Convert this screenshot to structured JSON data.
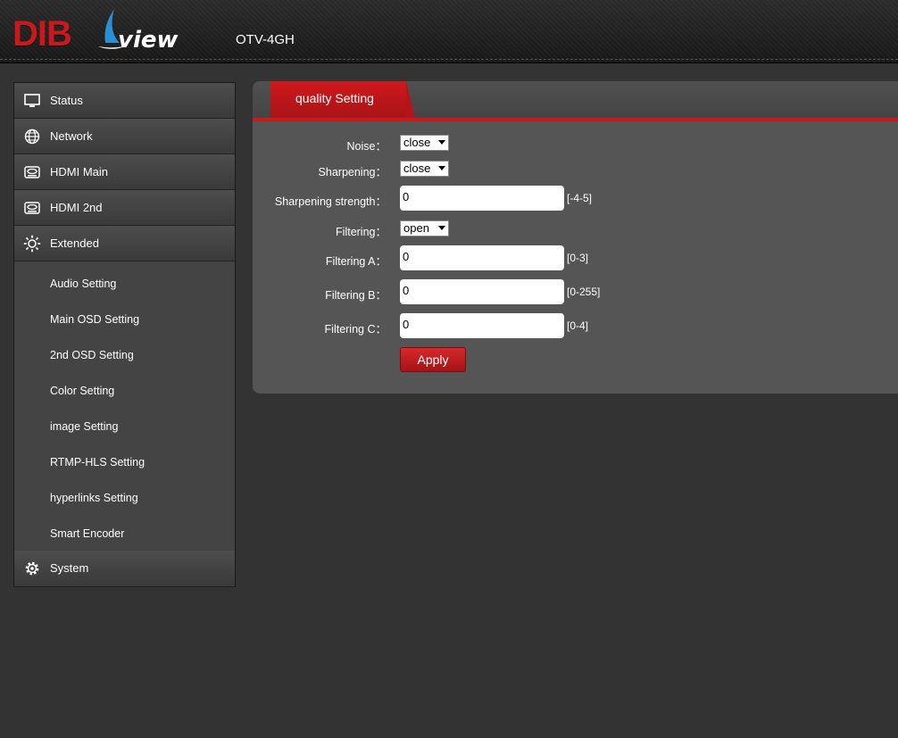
{
  "header": {
    "logo_main": "DIB",
    "logo_sub": "view",
    "model": "OTV-4GH"
  },
  "sidebar": {
    "items": [
      {
        "label": "Status",
        "icon": "monitor-icon"
      },
      {
        "label": "Network",
        "icon": "globe-icon"
      },
      {
        "label": "HDMI Main",
        "icon": "hdmi-icon"
      },
      {
        "label": "HDMI 2nd",
        "icon": "hdmi-icon"
      },
      {
        "label": "Extended",
        "icon": "sun-gear-icon"
      }
    ],
    "sub_items": [
      "Audio Setting",
      "Main OSD Setting",
      "2nd OSD Setting",
      "Color Setting",
      "image Setting",
      "RTMP-HLS Setting",
      "hyperlinks Setting",
      "Smart Encoder"
    ],
    "system": {
      "label": "System",
      "icon": "gear-icon"
    }
  },
  "panel": {
    "tab_label": "quality Setting",
    "fields": {
      "noise": {
        "label": "Noise：",
        "value": "close"
      },
      "sharpening": {
        "label": "Sharpening：",
        "value": "close"
      },
      "sharpening_strength": {
        "label": "Sharpening strength：",
        "value": "0",
        "range": "[-4-5]"
      },
      "filtering": {
        "label": "Filtering：",
        "value": "open"
      },
      "filtering_a": {
        "label": "Filtering A：",
        "value": "0",
        "range": "[0-3]"
      },
      "filtering_b": {
        "label": "Filtering B：",
        "value": "0",
        "range": "[0-255]"
      },
      "filtering_c": {
        "label": "Filtering C：",
        "value": "0",
        "range": "[0-4]"
      }
    },
    "apply_label": "Apply"
  }
}
